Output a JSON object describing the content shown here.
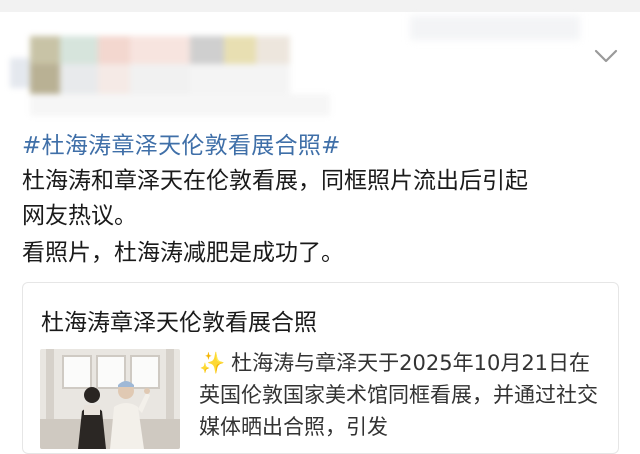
{
  "post": {
    "topic": "#杜海涛章泽天伦敦看展合照#",
    "lines": [
      "杜海涛和章泽天在伦敦看展，同框照片流出后引起",
      "网友热议。",
      "看照片，杜海涛减肥是成功了。"
    ]
  },
  "card": {
    "title": "杜海涛章泽天伦敦看展合照",
    "sparkle": "✨",
    "description": "杜海涛与章泽天于2025年10月21日在英国伦敦国家美术馆同框看展，并通过社交媒体晒出合照，引发"
  },
  "icons": {
    "collapse": "chevron-down-icon",
    "sparkle": "sparkles-icon"
  },
  "colors": {
    "topic_link": "#3f6fa8",
    "text": "#1a1a1a",
    "card_border": "#e6e6e6"
  }
}
